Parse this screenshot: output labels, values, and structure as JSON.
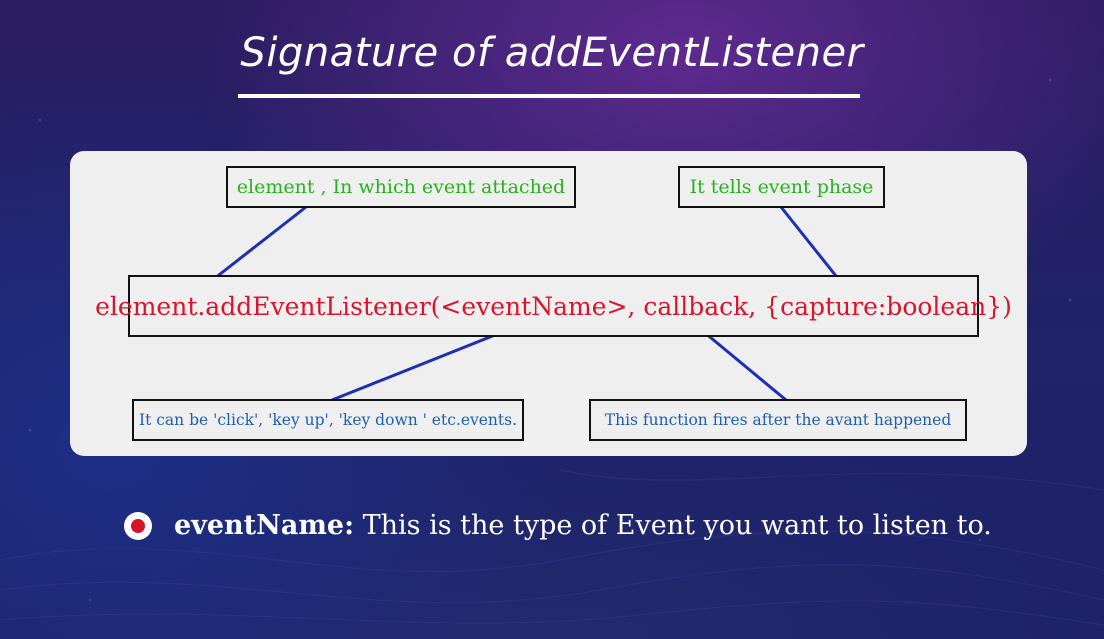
{
  "slide": {
    "title": "Signature of addEventListener"
  },
  "diagram": {
    "element_note": "element , In which event attached",
    "phase_note": "It tells event phase",
    "signature": "element.addEventListener(<eventName>, callback, {capture:boolean})",
    "eventname_note": "It can be 'click', 'key up', 'key down ' etc.events.",
    "callback_note": "This function fires after the avant happened"
  },
  "bullet": {
    "term": "eventName:",
    "description": " This is the type of Event you want to listen to."
  },
  "colors": {
    "note_green": "#28b21d",
    "signature_red": "#d9142d",
    "note_blue": "#1f5fb0",
    "connector_blue": "#1c2fb5",
    "bullet_red": "#d51428"
  }
}
